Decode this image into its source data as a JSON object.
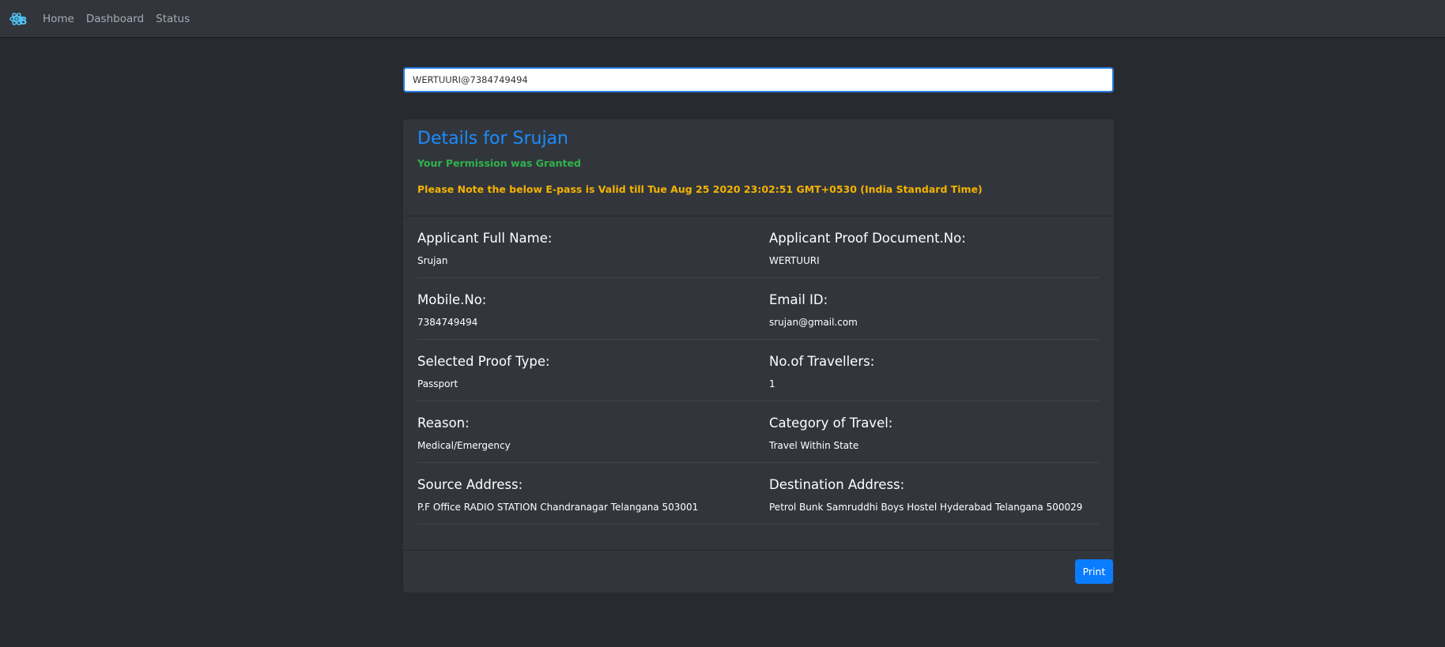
{
  "nav": {
    "brand_icon": "react-bootstrap-logo-icon",
    "links": [
      "Home",
      "Dashboard",
      "Status"
    ]
  },
  "search": {
    "value": "WERTUURI@7384749494"
  },
  "card": {
    "title": "Details for Srujan",
    "status": "Your Permission was Granted",
    "validity": "Please Note the below E-pass is Valid till Tue Aug 25 2020 23:02:51 GMT+0530 (India Standard Time)",
    "fields": [
      {
        "label": "Applicant Full Name:",
        "value": "Srujan"
      },
      {
        "label": "Applicant Proof Document.No:",
        "value": "WERTUURI"
      },
      {
        "label": "Mobile.No:",
        "value": "7384749494"
      },
      {
        "label": "Email ID:",
        "value": "srujan@gmail.com"
      },
      {
        "label": "Selected Proof Type:",
        "value": "Passport"
      },
      {
        "label": "No.of Travellers:",
        "value": "1"
      },
      {
        "label": "Reason:",
        "value": "Medical/Emergency"
      },
      {
        "label": "Category of Travel:",
        "value": "Travel Within State"
      },
      {
        "label": "Source Address:",
        "value": "P.F Office RADIO STATION Chandranagar Telangana 503001"
      },
      {
        "label": "Destination Address:",
        "value": "Petrol Bunk Samruddhi Boys Hostel Hyderabad Telangana 500029"
      }
    ],
    "print_label": "Print"
  },
  "colors": {
    "background": "#272b30",
    "navbar": "#32363c",
    "card": "#32363c",
    "title": "#1a8cff",
    "granted": "#2fb34a",
    "validity": "#f5b300",
    "primary_button": "#0a7cff",
    "brand_icon": "#4fc3f7"
  }
}
